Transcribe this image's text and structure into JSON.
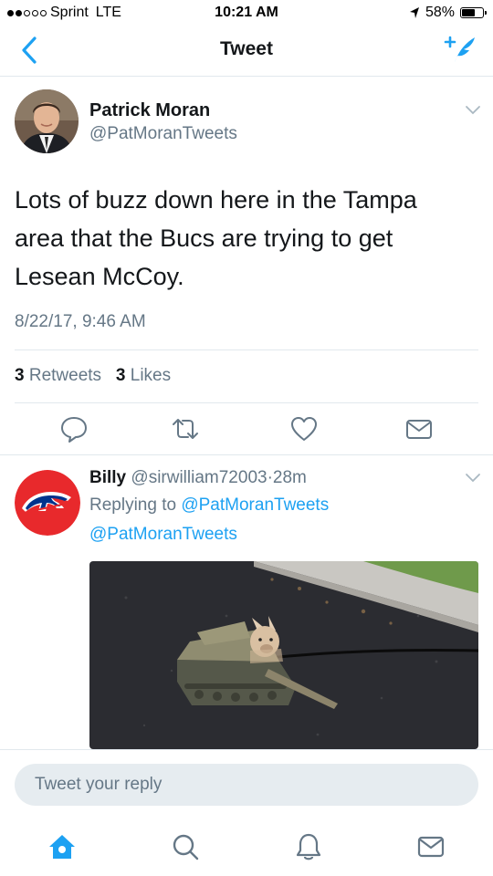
{
  "status_bar": {
    "carrier": "Sprint",
    "network": "LTE",
    "time": "10:21 AM",
    "battery_percent": "58%",
    "battery_level": 0.58,
    "signal_dots_filled": 2,
    "signal_dots_total": 5
  },
  "nav": {
    "title": "Tweet",
    "back_icon": "chevron-left-icon",
    "compose_icon": "compose-tweet-icon"
  },
  "tweet": {
    "author_name": "Patrick Moran",
    "author_handle": "@PatMoranTweets",
    "text": "Lots of buzz down here in the Tampa area that the Bucs are trying to get Lesean McCoy.",
    "timestamp": "8/22/17, 9:46 AM",
    "retweets_count": "3",
    "retweets_label": "Retweets",
    "likes_count": "3",
    "likes_label": "Likes",
    "actions": [
      "reply-icon",
      "retweet-icon",
      "like-icon",
      "direct-message-icon"
    ]
  },
  "reply": {
    "author_name": "Billy",
    "author_handle": "@sirwilliam72003",
    "separator": "·",
    "time_ago": "28m",
    "replying_prefix": "Replying to",
    "replying_to": "@PatMoranTweets",
    "text": "@PatMoranTweets"
  },
  "reply_input": {
    "placeholder": "Tweet your reply"
  },
  "tabbar": {
    "items": [
      "home-icon",
      "search-icon",
      "notifications-icon",
      "messages-icon"
    ],
    "active": "home-icon"
  },
  "colors": {
    "accent": "#1da1f2",
    "secondary_text": "#657786",
    "primary_text": "#14171a",
    "divider": "#e1e8ed"
  }
}
